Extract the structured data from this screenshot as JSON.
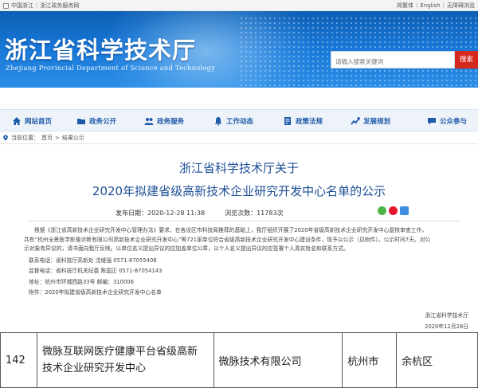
{
  "topbar": {
    "left_links": [
      "中国浙江",
      "浙江政务服务网"
    ],
    "right_links": [
      "简繁体",
      "English",
      "无障碍浏览"
    ]
  },
  "banner": {
    "title_cn": "浙江省科学技术厅",
    "title_en": "Zhejiang Provincial Department of Science and Technology",
    "search_placeholder": "请输入搜索关键词",
    "search_button": "搜索"
  },
  "nav": {
    "items": [
      {
        "label": "网站首页",
        "icon": "home-icon"
      },
      {
        "label": "政务公开",
        "icon": "folder-icon"
      },
      {
        "label": "政务服务",
        "icon": "people-icon"
      },
      {
        "label": "工作动态",
        "icon": "bell-icon"
      },
      {
        "label": "政策法规",
        "icon": "document-icon"
      },
      {
        "label": "发展规划",
        "icon": "chart-icon"
      },
      {
        "label": "公众参与",
        "icon": "chat-icon"
      }
    ]
  },
  "breadcrumb": {
    "prefix": "当前位置：",
    "items": [
      "首页",
      "结果公示"
    ],
    "separator": ">"
  },
  "article": {
    "title_line1": "浙江省科学技术厅关于",
    "title_line2": "2020年拟建省级高新技术企业研究开发中心名单的公示",
    "publish_time": "发布日期：2020-12-28 11:38",
    "views": "浏览次数：11783次",
    "paragraphs": [
      "根据《浙江省高新技术企业研究开发中心管理办法》要求，在各设区市科技局推荐的基础上，我厅组织开展了2020年省级高新技术企业研究开发中心复核审查工作，",
      "共有“杭州全景医学影像诊断有限公司高新技术企业研究开发中心”等721家单位符合省级高新技术企业研究开发中心建设条件，现予以公示（见附件）。公示时间7天。对公",
      "示对象有异议的，请书面向我厅反映。以单位名义提出异议的应加盖单位公章，以个人名义提出异议的应签署个人真实姓名和联系方式。"
    ],
    "contacts": [
      "联系电话：省科技厅高新处    沈维强  0571-87055408",
      "监督电话：省科技厅机关纪委  陈国正  0571-87054143",
      "地址：杭州市环城西路33号    邮编：310006",
      "附件：2020年拟建省级高新技术企业研究开发中心名单"
    ],
    "signature_org": "浙江省科学技术厅",
    "signature_date": "2020年12月28日"
  },
  "table": {
    "row": {
      "index": "142",
      "name_line1": "微脉互联网医疗健康平台省级高新",
      "name_line2": "技术企业研究开发中心",
      "company": "微脉技术有限公司",
      "city": "杭州市",
      "district": "余杭区"
    }
  },
  "colors": {
    "banner_blue": "#1776d6",
    "nav_text": "#1e5aa8",
    "title_blue": "#1d4f96",
    "search_red": "#d7281e"
  }
}
